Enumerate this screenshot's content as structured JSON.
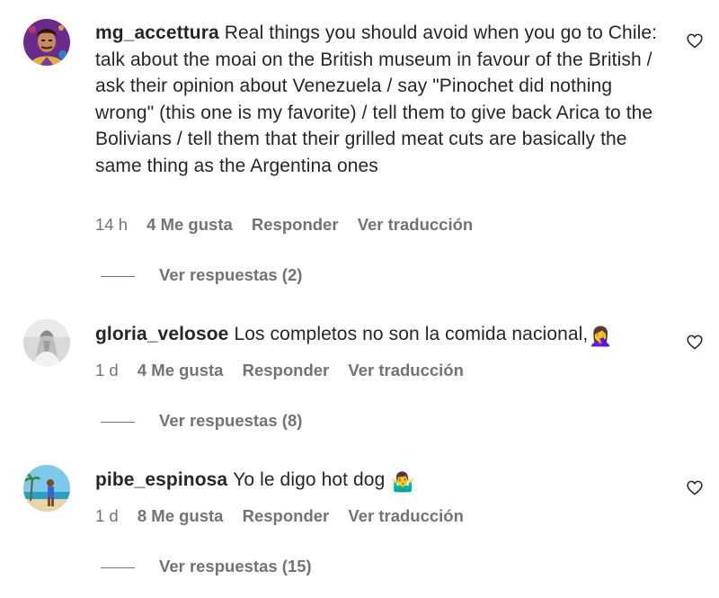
{
  "comments": [
    {
      "username": "mg_accettura",
      "text": "Real things you should avoid when you go to Chile: talk about the moai on the British museum in favour of the British / ask their opinion about Venezuela / say \"Pinochet did nothing wrong\" (this one is my favorite) / tell them to give back Arica to the Bolivians / tell them that their grilled meat cuts are basically the same thing as the Argentina ones",
      "time": "14 h",
      "likes": "4 Me gusta",
      "reply_label": "Responder",
      "translate_label": "Ver traducción",
      "view_replies": "Ver respuestas (2)",
      "avatar_icon": "cartoon-portrait-avatar",
      "like_icon": "heart-outline-icon"
    },
    {
      "username": "gloria_velosoe",
      "text": "Los completos no son la comida nacional,",
      "emoji": "🤦‍♀️",
      "time": "1 d",
      "likes": "4 Me gusta",
      "reply_label": "Responder",
      "translate_label": "Ver traducción",
      "view_replies": "Ver respuestas (8)",
      "avatar_icon": "grayscale-photo-avatar",
      "like_icon": "heart-outline-icon"
    },
    {
      "username": "pibe_espinosa",
      "text": "Yo le digo hot dog",
      "emoji": "🤷‍♂️",
      "time": "1 d",
      "likes": "8 Me gusta",
      "reply_label": "Responder",
      "translate_label": "Ver traducción",
      "view_replies": "Ver respuestas (15)",
      "avatar_icon": "beach-photo-avatar",
      "like_icon": "heart-outline-icon"
    }
  ],
  "colors": {
    "text": "#262626",
    "secondary": "#737373",
    "background": "#ffffff"
  }
}
